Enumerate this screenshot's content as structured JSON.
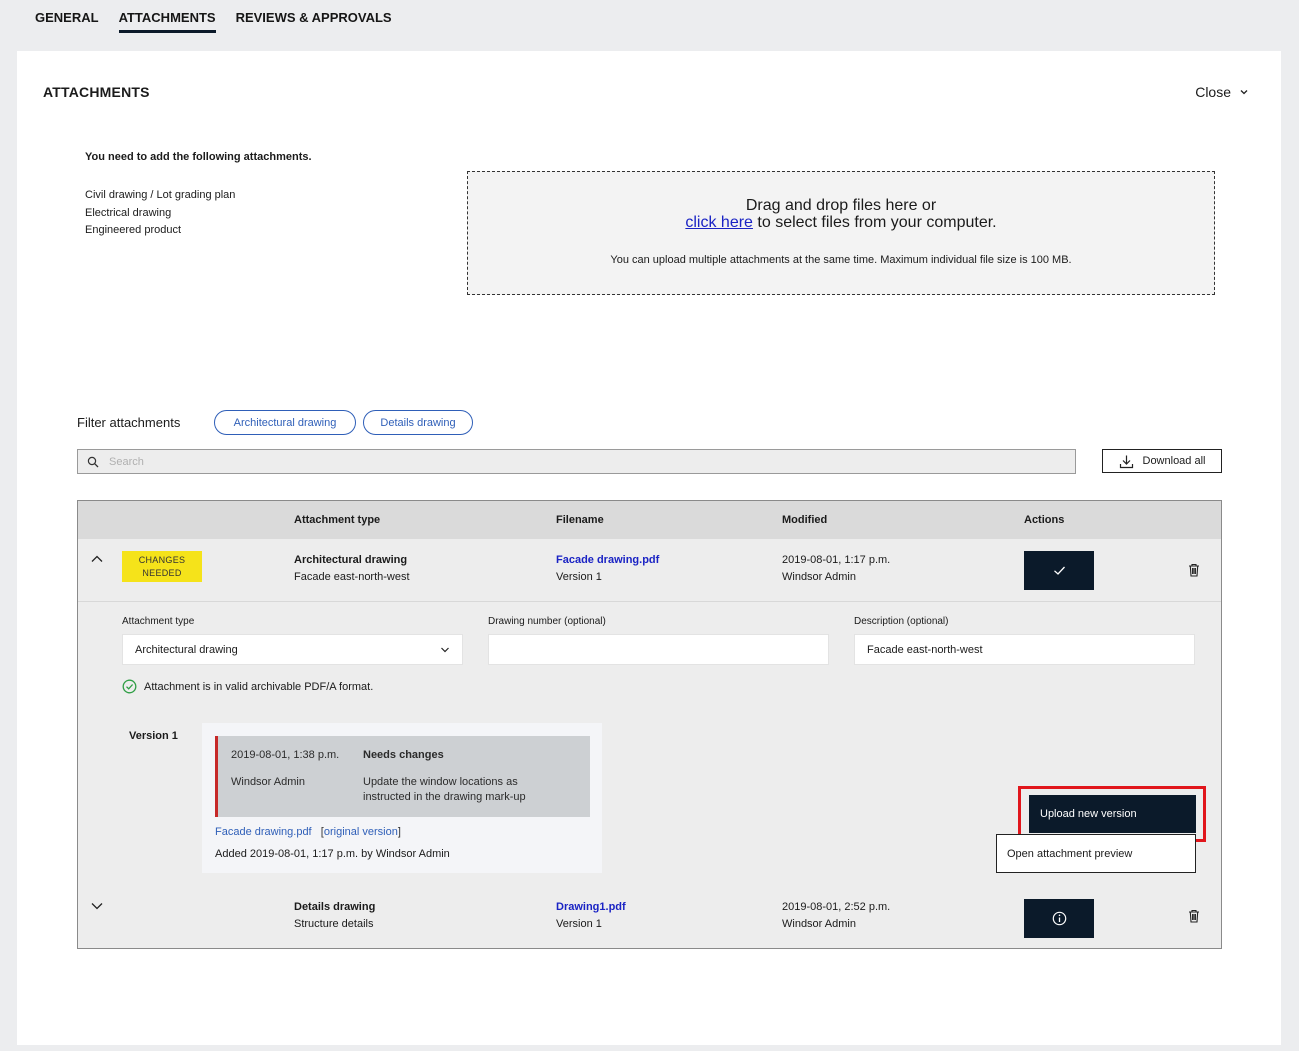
{
  "tabs": [
    {
      "label": "GENERAL",
      "active": false
    },
    {
      "label": "ATTACHMENTS",
      "active": true
    },
    {
      "label": "REVIEWS & APPROVALS",
      "active": false
    }
  ],
  "panel": {
    "title": "ATTACHMENTS",
    "close_label": "Close"
  },
  "required": {
    "title": "You need to add the following attachments.",
    "items": [
      "Civil drawing / Lot grading plan",
      "Electrical drawing",
      "Engineered product"
    ]
  },
  "dropzone": {
    "line1": "Drag and drop files here or",
    "link": "click here",
    "line2_rest": " to select files from your computer.",
    "note": "You can upload multiple attachments at the same time. Maximum individual file size is 100 MB."
  },
  "filter": {
    "label": "Filter attachments",
    "chips": [
      "Architectural drawing",
      "Details drawing"
    ]
  },
  "search": {
    "placeholder": "Search"
  },
  "download_all": "Download all",
  "table": {
    "headers": {
      "type": "Attachment type",
      "filename": "Filename",
      "modified": "Modified",
      "actions": "Actions"
    },
    "rows": [
      {
        "badge": "CHANGES NEEDED",
        "type": "Architectural drawing",
        "subtype": "Facade east-north-west",
        "filename": "Facade drawing.pdf",
        "version": "Version 1",
        "modified": "2019-08-01, 1:17 p.m.",
        "modified_by": "Windsor Admin",
        "action_icon": "check-icon",
        "expanded": true
      },
      {
        "badge": "",
        "type": "Details drawing",
        "subtype": "Structure details",
        "filename": "Drawing1.pdf",
        "version": "Version 1",
        "modified": "2019-08-01, 2:52 p.m.",
        "modified_by": "Windsor Admin",
        "action_icon": "info-icon",
        "expanded": false
      }
    ]
  },
  "details": {
    "attachment_type_label": "Attachment type",
    "attachment_type_value": "Architectural drawing",
    "drawing_number_label": "Drawing number (optional)",
    "drawing_number_value": "",
    "description_label": "Description (optional)",
    "description_value": "Facade east-north-west",
    "valid_text": "Attachment is in valid archivable PDF/A format.",
    "version_label": "Version 1",
    "note_date": "2019-08-01, 1:38 p.m.",
    "note_status": "Needs changes",
    "note_author": "Windsor Admin",
    "note_text_1": "Update the window locations as",
    "note_text_2": "instructed in the drawing mark-up",
    "file_link": "Facade drawing.pdf",
    "original_link": "original version",
    "added_text": "Added 2019-08-01, 1:17 p.m. by Windsor Admin",
    "upload_label": "Upload new version",
    "preview_label": "Open attachment preview"
  },
  "colors": {
    "accent_dark": "#0b1a2a",
    "badge_yellow": "#f5e31a",
    "link_blue": "#1a23c4",
    "chip_blue": "#2f5fb8",
    "highlight_red": "#e1161c",
    "note_red": "#c62828",
    "valid_green": "#2e9e44"
  }
}
